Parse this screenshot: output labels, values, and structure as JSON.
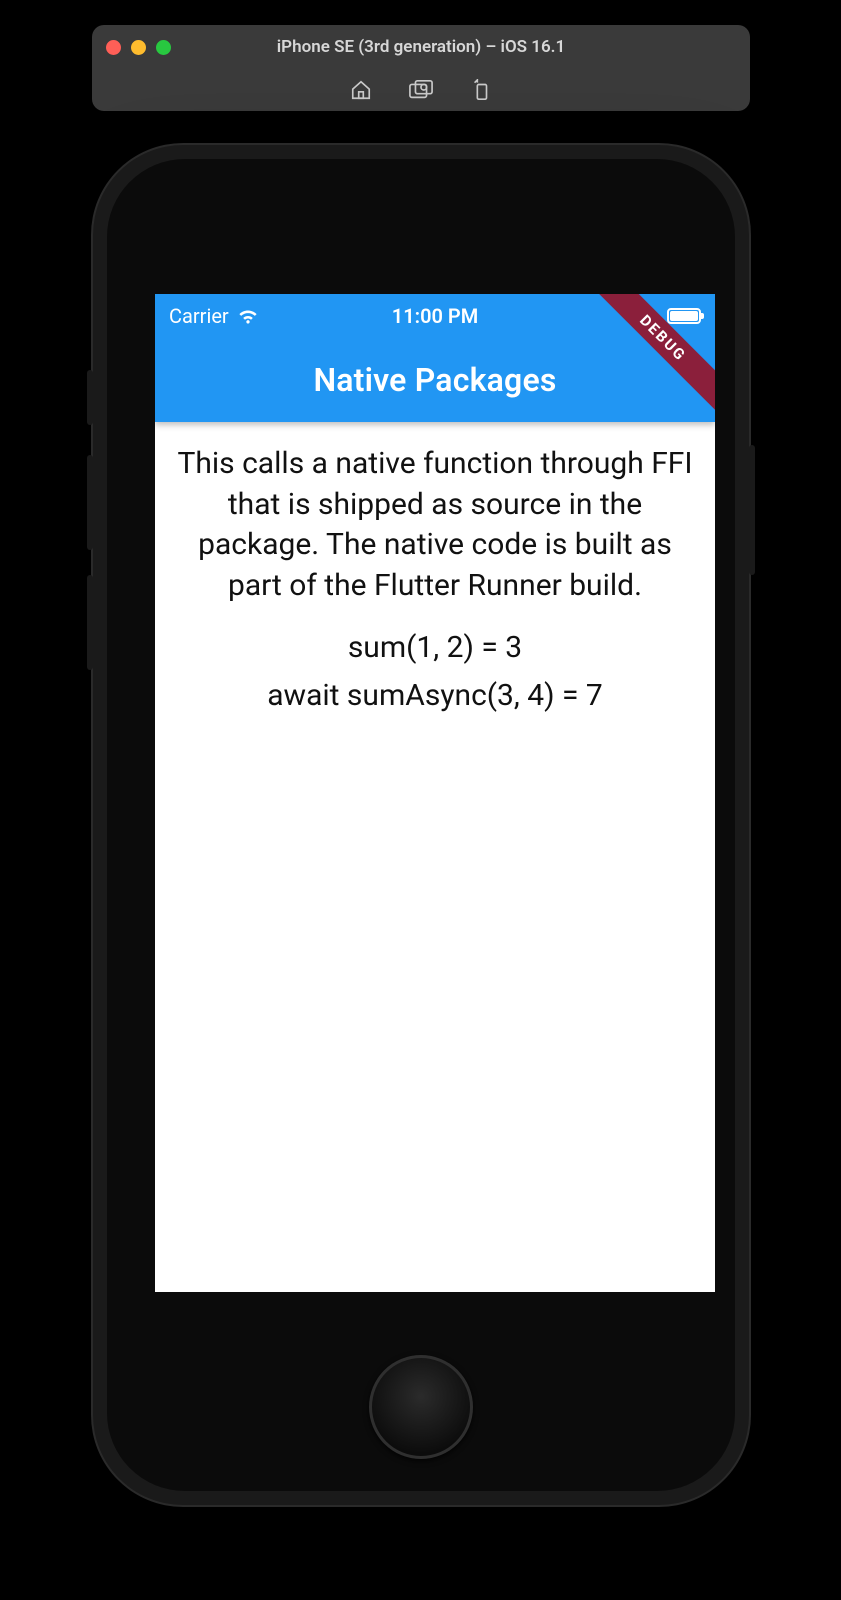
{
  "simulator": {
    "window_title": "iPhone SE (3rd generation) – iOS 16.1",
    "traffic_lights": {
      "red": "#ff5f57",
      "yellow": "#febc2e",
      "green": "#28c840"
    },
    "actions": {
      "home_icon": "home-icon",
      "screenshot_icon": "screenshot-icon",
      "rotate_icon": "rotate-icon"
    }
  },
  "status": {
    "carrier": "Carrier",
    "time": "11:00 PM",
    "wifi_icon": "wifi-icon",
    "battery_icon": "battery-icon"
  },
  "app": {
    "title": "Native Packages",
    "debug_banner": "DEBUG",
    "accent_color": "#2196f3"
  },
  "body": {
    "description": "This calls a native function through FFI that is shipped as source in the package. The native code is built as part of the Flutter Runner build.",
    "result_sum": "sum(1, 2) = 3",
    "result_sum_async": "await sumAsync(3, 4) = 7"
  }
}
